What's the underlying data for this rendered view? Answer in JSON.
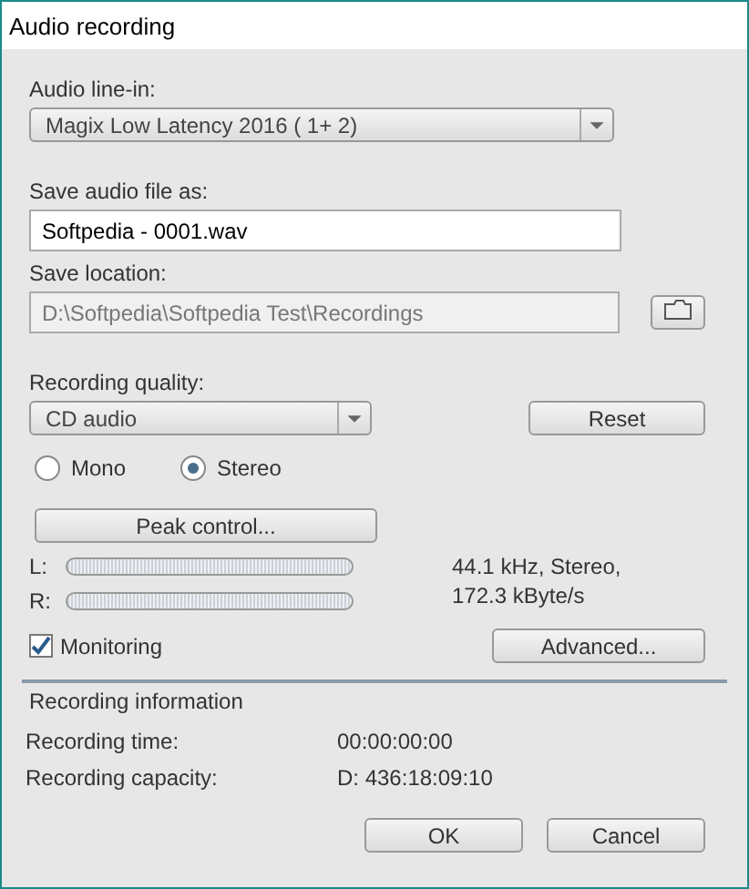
{
  "window": {
    "title": "Audio recording"
  },
  "line_in": {
    "label": "Audio line-in:",
    "value": "Magix Low Latency 2016 ( 1+ 2)"
  },
  "file_name": {
    "label": "Save audio file as:",
    "value": "Softpedia - 0001.wav"
  },
  "location": {
    "label": "Save location:",
    "value": "D:\\Softpedia\\Softpedia Test\\Recordings",
    "disabled": true
  },
  "quality": {
    "label": "Recording quality:",
    "value": "CD audio",
    "reset": "Reset"
  },
  "channels": [
    {
      "label": "Mono",
      "selected": false
    },
    {
      "label": "Stereo",
      "selected": true
    }
  ],
  "peak_button": "Peak control...",
  "meters": [
    {
      "label": "L:",
      "level": 0
    },
    {
      "label": "R:",
      "level": 0
    }
  ],
  "format_info": [
    "44.1 kHz, Stereo,",
    "172.3 kByte/s"
  ],
  "monitoring": {
    "label": "Monitoring",
    "checked": true
  },
  "advanced_button": "Advanced...",
  "info": {
    "title": "Recording information",
    "rows": [
      {
        "label": "Recording time:",
        "value": "00:00:00:00"
      },
      {
        "label": "Recording capacity:",
        "value": "D: 436:18:09:10"
      }
    ]
  },
  "buttons": [
    "OK",
    "Cancel"
  ]
}
